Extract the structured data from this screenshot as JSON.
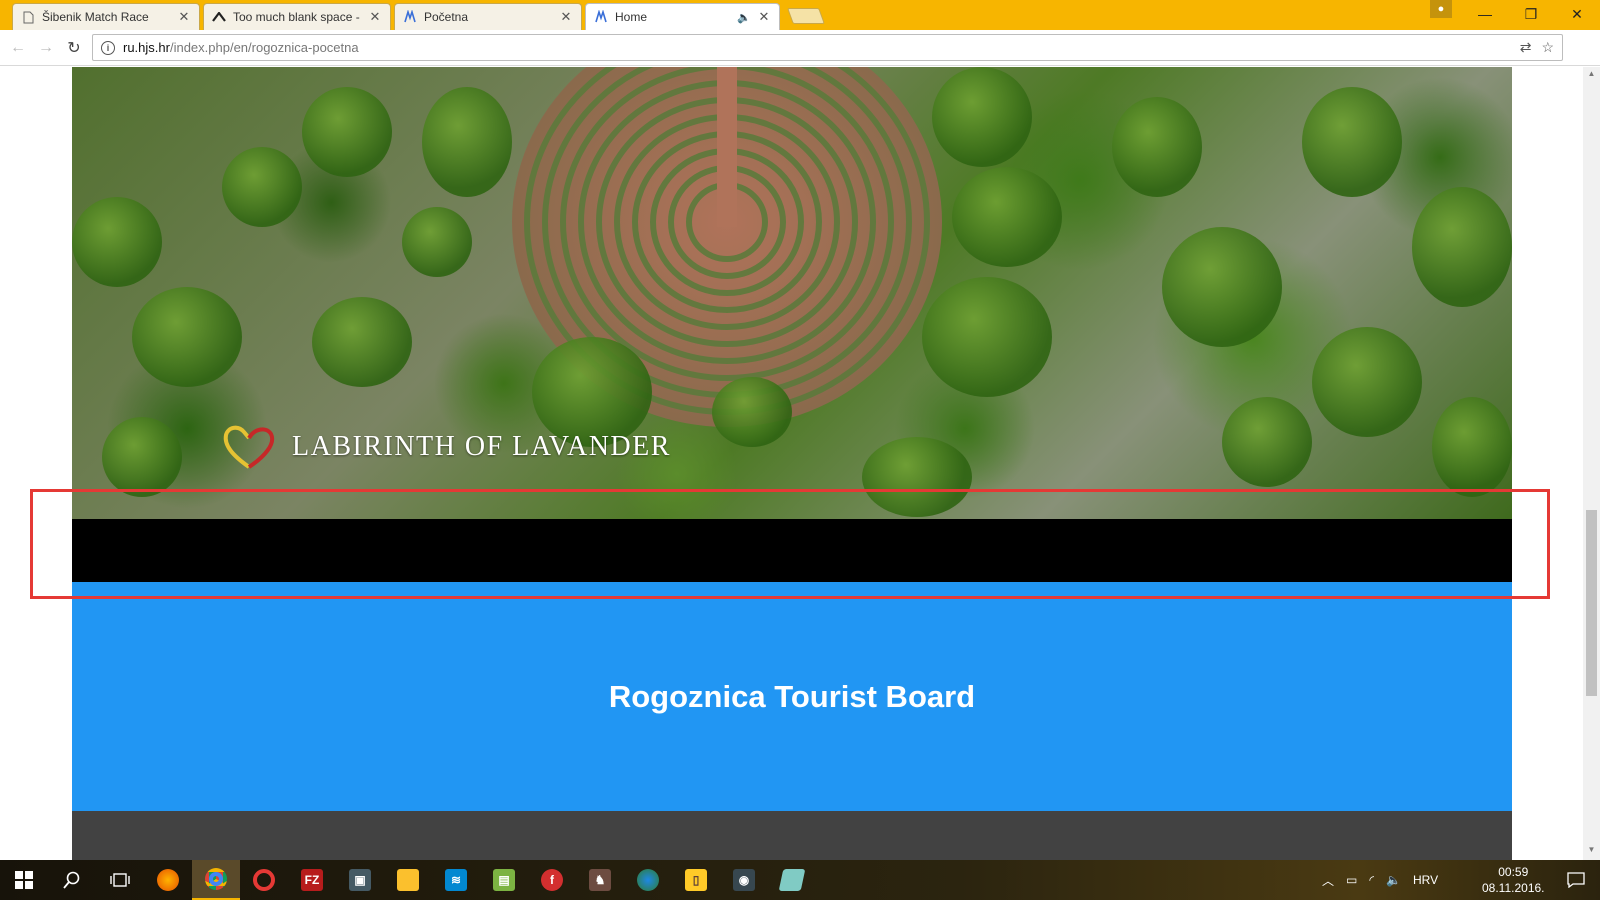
{
  "browser": {
    "tabs": [
      {
        "title": "Šibenik Match Race",
        "icon": "page-icon"
      },
      {
        "title": "Too much blank space -",
        "icon": "stack-exchange-icon"
      },
      {
        "title": "Početna",
        "icon": "site-favicon-icon"
      },
      {
        "title": "Home",
        "icon": "site-favicon-icon",
        "active": true,
        "audio": true
      }
    ],
    "url_host": "ru.hjs.hr",
    "url_path": "/index.php/en/rogoznica-pocetna"
  },
  "page": {
    "hero_label": "LABIRINTH OF LAVANDER",
    "section_title": "Rogoznica Tourist Board",
    "colors": {
      "blue": "#2196f3",
      "black": "#000000",
      "dark": "#424242",
      "highlight": "#e53935"
    }
  },
  "taskbar": {
    "language": "HRV",
    "time": "00:59",
    "date": "08.11.2016."
  }
}
